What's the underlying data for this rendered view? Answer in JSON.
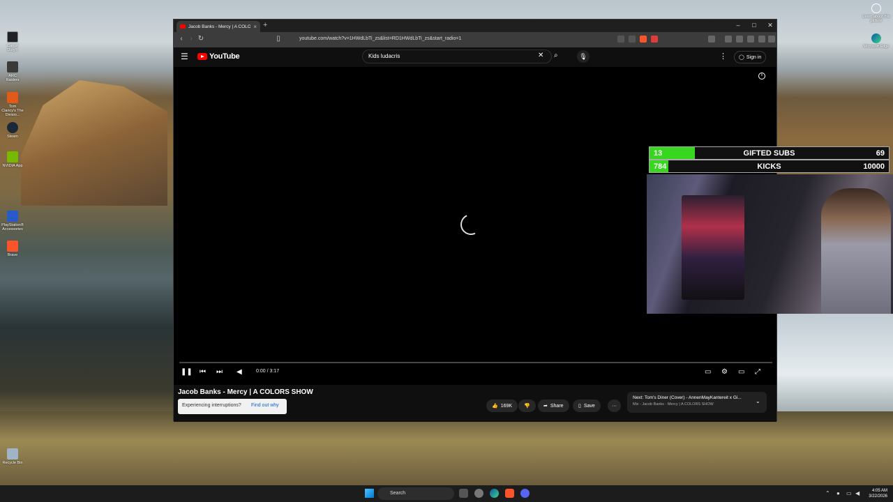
{
  "desktop": {
    "icons": [
      {
        "label": "Call of Duty®",
        "color": "#222222"
      },
      {
        "label": "ARC Raiders",
        "color": "#3a3a3a"
      },
      {
        "label": "Tom Clancy's The Divisio...",
        "color": "#e05a1a"
      },
      {
        "label": "Steam",
        "color": "#1b2838"
      },
      {
        "label": "NVIDIA App",
        "color": "#76b900"
      },
      {
        "label": "PlayStation® Accessories",
        "color": "#2a5ac8"
      },
      {
        "label": "Brave",
        "color": "#fb542b"
      }
    ],
    "bottom_icon": "Recycle Bin",
    "right_icons": [
      {
        "label": "Learn about this picture"
      },
      {
        "label": "Microsoft Edge"
      }
    ]
  },
  "browser": {
    "tab_title": "Jacob Banks - Mercy | A COLORS",
    "url": "youtube.com/watch?v=1HWdLbTi_zs&list=RD1HWdLbTi_zs&start_radio=1"
  },
  "youtube": {
    "logo": "YouTube",
    "search_value": "Kids ludacris",
    "signin": "Sign in",
    "player": {
      "time": "0:00 / 3:17"
    },
    "video_title": "Jacob Banks - Mercy | A COLORS SHOW",
    "interrupt_text": "Experiencing interruptions?",
    "interrupt_link": "Find out why",
    "likes": "169K",
    "share": "Share",
    "save": "Save",
    "next": {
      "title": "Next: Tom's Diner (Cover) - AnnenMayKantereit x Gi...",
      "subtitle": "Mix - Jacob Banks - Mercy | A COLORS SHOW"
    }
  },
  "overlay": {
    "gifted": {
      "current": "13",
      "label": "GIFTED SUBS",
      "goal": "69",
      "progress": 0.19
    },
    "kicks": {
      "current": "784",
      "label": "KICKS",
      "goal": "10000",
      "progress": 0.078
    }
  },
  "taskbar": {
    "search": "Search",
    "time": "4:05 AM",
    "date": "3/22/2026"
  },
  "colors": {
    "progress_fill": "#37d61f",
    "youtube_red": "#ff0000"
  }
}
